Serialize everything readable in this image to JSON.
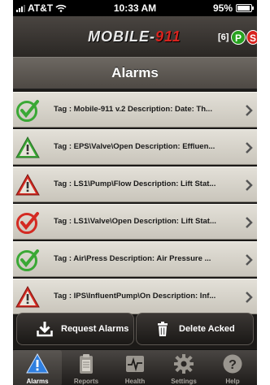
{
  "status_bar": {
    "carrier": "AT&T",
    "time": "10:33 AM",
    "battery": "95%"
  },
  "brand": {
    "logo_main": "MOBILE-",
    "logo_accent": "911",
    "count": "[6]",
    "p_badge": "P",
    "s_badge": "S"
  },
  "title": "Alarms",
  "alarms": [
    {
      "status": "ok",
      "icon": "green-check-icon",
      "text": "Tag : Mobile-911 v.2  Description:  Date: Th..."
    },
    {
      "status": "warning",
      "icon": "green-warning-triangle-icon",
      "text": "Tag : EPS\\Valve\\Open  Description:  Effluen..."
    },
    {
      "status": "alarm",
      "icon": "red-warning-triangle-icon",
      "text": "Tag : LS1\\Pump\\Flow  Description:  Lift Stat..."
    },
    {
      "status": "acked",
      "icon": "red-check-icon",
      "text": "Tag : LS1\\Valve\\Open  Description:  Lift Stat..."
    },
    {
      "status": "ok",
      "icon": "green-check-icon",
      "text": "Tag : Air\\Press  Description:  Air Pressure ..."
    },
    {
      "status": "alarm",
      "icon": "red-warning-triangle-icon",
      "text": "Tag : IPS\\InfluentPump\\On  Description:  Inf..."
    }
  ],
  "actions": {
    "request_label": "Request Alarms",
    "delete_label": "Delete Acked"
  },
  "tabs": [
    {
      "label": "Alarms",
      "icon": "alarm-triangle-icon",
      "active": true
    },
    {
      "label": "Reports",
      "icon": "clipboard-icon",
      "active": false
    },
    {
      "label": "Health",
      "icon": "heartbeat-icon",
      "active": false
    },
    {
      "label": "Settings",
      "icon": "gear-icon",
      "active": false
    },
    {
      "label": "Help",
      "icon": "help-icon",
      "active": false
    }
  ],
  "colors": {
    "green": "#3aa835",
    "red": "#d42a22",
    "active_tab_blue": "#2f7fe0"
  }
}
